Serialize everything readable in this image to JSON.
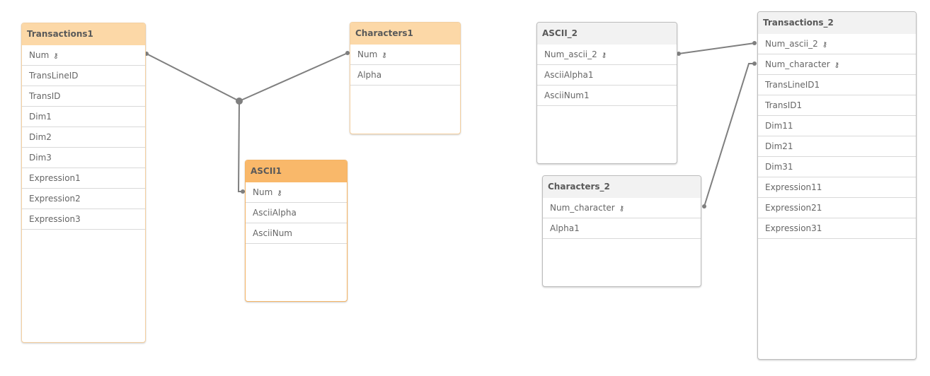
{
  "colors": {
    "header_orange_light": "#fcd8a7",
    "header_orange_dark": "#f9b86a",
    "header_grey": "#f2f2f2",
    "link": "#7f7f7f"
  },
  "tables": [
    {
      "id": "transactions1",
      "name": "Transactions1",
      "style": "orange-light",
      "fields": [
        {
          "name": "Num",
          "key": true
        },
        {
          "name": "TransLineID"
        },
        {
          "name": "TransID"
        },
        {
          "name": "Dim1"
        },
        {
          "name": "Dim2"
        },
        {
          "name": "Dim3"
        },
        {
          "name": "Expression1"
        },
        {
          "name": "Expression2"
        },
        {
          "name": "Expression3"
        }
      ]
    },
    {
      "id": "characters1",
      "name": "Characters1",
      "style": "orange-light",
      "fields": [
        {
          "name": "Num",
          "key": true
        },
        {
          "name": "Alpha"
        }
      ]
    },
    {
      "id": "ascii1",
      "name": "ASCII1",
      "style": "orange-dark",
      "fields": [
        {
          "name": "Num",
          "key": true
        },
        {
          "name": "AsciiAlpha"
        },
        {
          "name": "AsciiNum"
        }
      ]
    },
    {
      "id": "ascii_2",
      "name": "ASCII_2",
      "style": "grey",
      "fields": [
        {
          "name": "Num_ascii_2",
          "key": true
        },
        {
          "name": "AsciiAlpha1"
        },
        {
          "name": "AsciiNum1"
        }
      ]
    },
    {
      "id": "characters_2",
      "name": "Characters_2",
      "style": "grey",
      "fields": [
        {
          "name": "Num_character",
          "key": true
        },
        {
          "name": "Alpha1"
        }
      ]
    },
    {
      "id": "transactions_2",
      "name": "Transactions_2",
      "style": "grey",
      "fields": [
        {
          "name": "Num_ascii_2",
          "key": true
        },
        {
          "name": "Num_character",
          "key": true
        },
        {
          "name": "TransLineID1"
        },
        {
          "name": "TransID1"
        },
        {
          "name": "Dim11"
        },
        {
          "name": "Dim21"
        },
        {
          "name": "Dim31"
        },
        {
          "name": "Expression11"
        },
        {
          "name": "Expression21"
        },
        {
          "name": "Expression31"
        }
      ]
    }
  ],
  "key_icon": "key-icon"
}
